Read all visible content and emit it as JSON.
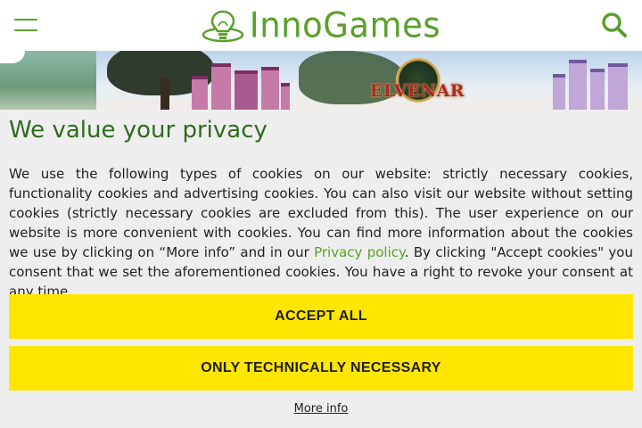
{
  "header": {
    "brand": "InnoGames",
    "colors": {
      "brand_green": "#5aa02c",
      "background": "#ffffff"
    },
    "icons": {
      "menu": "hamburger-menu-icon",
      "search": "search-icon"
    }
  },
  "banner": {
    "game_logo_text": "ELVENAR"
  },
  "consent": {
    "title": "We value your privacy",
    "text_before_link": "We use the following types of cookies on our website: strictly necessary cookies, functionality cookies and advertising cookies. You can also visit our website without setting cookies (strictly necessary cookies are excluded from this). The user experience on our website is more convenient with cookies. You can find more information about the cookies we use by clicking on “More info” and in our ",
    "privacy_link": "Privacy policy",
    "text_after_link": ". By clicking \"Accept cookies\" you consent that we set the aforementioned cookies. You have a right to revoke your consent at any time.",
    "accept_all_label": "ACCEPT ALL",
    "necessary_label": "ONLY TECHNICALLY NECESSARY",
    "more_info_label": "More info",
    "colors": {
      "title": "#2f6b1f",
      "button": "#ffe600",
      "panel": "#eeeeee",
      "link": "#5aa02c"
    }
  }
}
